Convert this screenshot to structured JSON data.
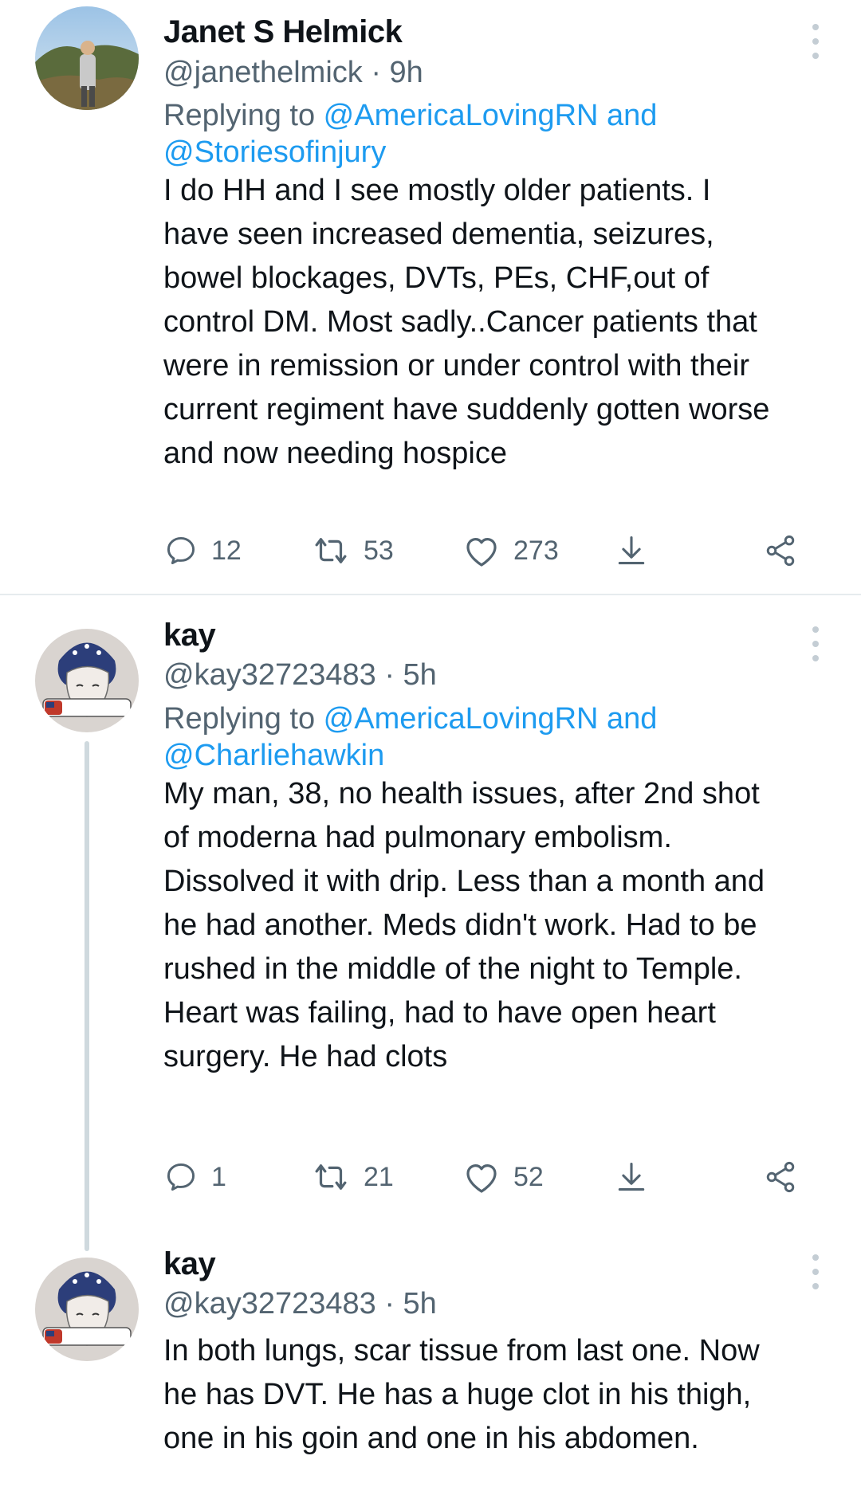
{
  "tweets": [
    {
      "name": "Janet S Helmick",
      "handle": "@janethelmick · 9h",
      "reply_prefix": "Replying to ",
      "reply_line1_mention": "@AmericaLovingRN and",
      "reply_line2_mention": "@Storiesofinjury",
      "text": "I do HH and I see mostly older patients. I\nhave seen increased dementia, seizures,\nbowel blockages, DVTs, PEs, CHF,out of\ncontrol DM. Most sadly..Cancer patients that\nwere in remission or under control with their\ncurrent regiment have suddenly gotten worse\nand now needing hospice",
      "replies": "12",
      "retweets": "53",
      "likes": "273"
    },
    {
      "name": "kay",
      "handle": "@kay32723483 · 5h",
      "reply_prefix": "Replying to ",
      "reply_line1_mention": "@AmericaLovingRN and",
      "reply_line2_mention": "@Charliehawkin",
      "text": "My man, 38, no health issues, after 2nd shot\nof moderna had pulmonary embolism.\nDissolved it with drip. Less than a month and\nhe had another. Meds didn't work. Had to be\nrushed in the middle of the night to Temple.\nHeart was failing, had to have open heart\nsurgery. He had clots",
      "replies": "1",
      "retweets": "21",
      "likes": "52"
    },
    {
      "name": "kay",
      "handle": "@kay32723483 · 5h",
      "text": "In both lungs, scar tissue from last one. Now\nhe has DVT.  He has a huge clot in his thigh,\none in his goin and one in his abdomen."
    }
  ],
  "colors": {
    "text": "#0f1419",
    "secondary": "#536471",
    "link": "#1d9bf0",
    "divider": "#e6ebee",
    "thread_line": "#cfd9de"
  },
  "icons": [
    "reply-icon",
    "retweet-icon",
    "like-icon",
    "bookmark-icon",
    "share-icon",
    "more-options-icon"
  ]
}
